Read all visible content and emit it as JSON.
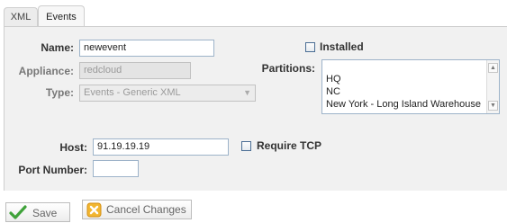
{
  "tabs": [
    {
      "label": "XML"
    },
    {
      "label": "Events"
    }
  ],
  "form": {
    "name": {
      "label": "Name:",
      "value": "newevent"
    },
    "appliance": {
      "label": "Appliance:",
      "value": "redcloud"
    },
    "type": {
      "label": "Type:",
      "value": "Events - Generic XML"
    },
    "installed": {
      "label": "Installed",
      "checked": false
    },
    "partitions": {
      "label": "Partitions:",
      "options": [
        "HQ",
        "NC",
        "New York - Long Island Warehouse"
      ]
    },
    "host": {
      "label": "Host:",
      "value": "91.19.19.19"
    },
    "require_tcp": {
      "label": "Require TCP",
      "checked": false
    },
    "port_number": {
      "label": "Port Number:",
      "value": ""
    }
  },
  "actions": {
    "save_label": "Save",
    "cancel_label": "Cancel Changes"
  },
  "colors": {
    "panel_bg": "#f1f1f1",
    "save_check": "#3fa23a",
    "cancel_x_bg": "#f2b630",
    "cancel_x": "#ffffff"
  }
}
